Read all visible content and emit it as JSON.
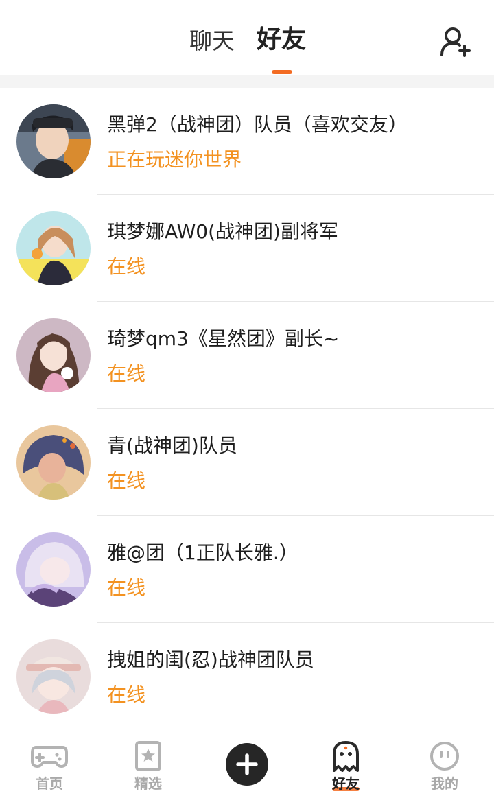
{
  "header": {
    "tabs": [
      {
        "label": "聊天",
        "active": false
      },
      {
        "label": "好友",
        "active": true
      }
    ],
    "accent_color": "#f36b22",
    "add_friend_icon": "add-user-icon"
  },
  "friends": [
    {
      "name": "黑弹2（战神团）队员（喜欢交友）",
      "status": "正在玩迷你世界"
    },
    {
      "name": "琪梦娜AW0(战神团)副将军",
      "status": "在线"
    },
    {
      "name": "琦梦qm3《星然团》副长~",
      "status": "在线"
    },
    {
      "name": "青(战神团)队员",
      "status": "在线"
    },
    {
      "name": "雅@团（1正队长雅.）",
      "status": "在线"
    },
    {
      "name": "拽姐的闺(忍)战神团队员",
      "status": "在线"
    }
  ],
  "status_color": "#f39221",
  "tabbar": {
    "items": [
      {
        "label": "首页",
        "icon": "gamepad-icon",
        "active": false
      },
      {
        "label": "精选",
        "icon": "star-bookmark-icon",
        "active": false
      },
      {
        "label": "",
        "icon": "plus-icon",
        "active": false
      },
      {
        "label": "好友",
        "icon": "ghost-friends-icon",
        "active": true
      },
      {
        "label": "我的",
        "icon": "face-icon",
        "active": false
      }
    ]
  }
}
